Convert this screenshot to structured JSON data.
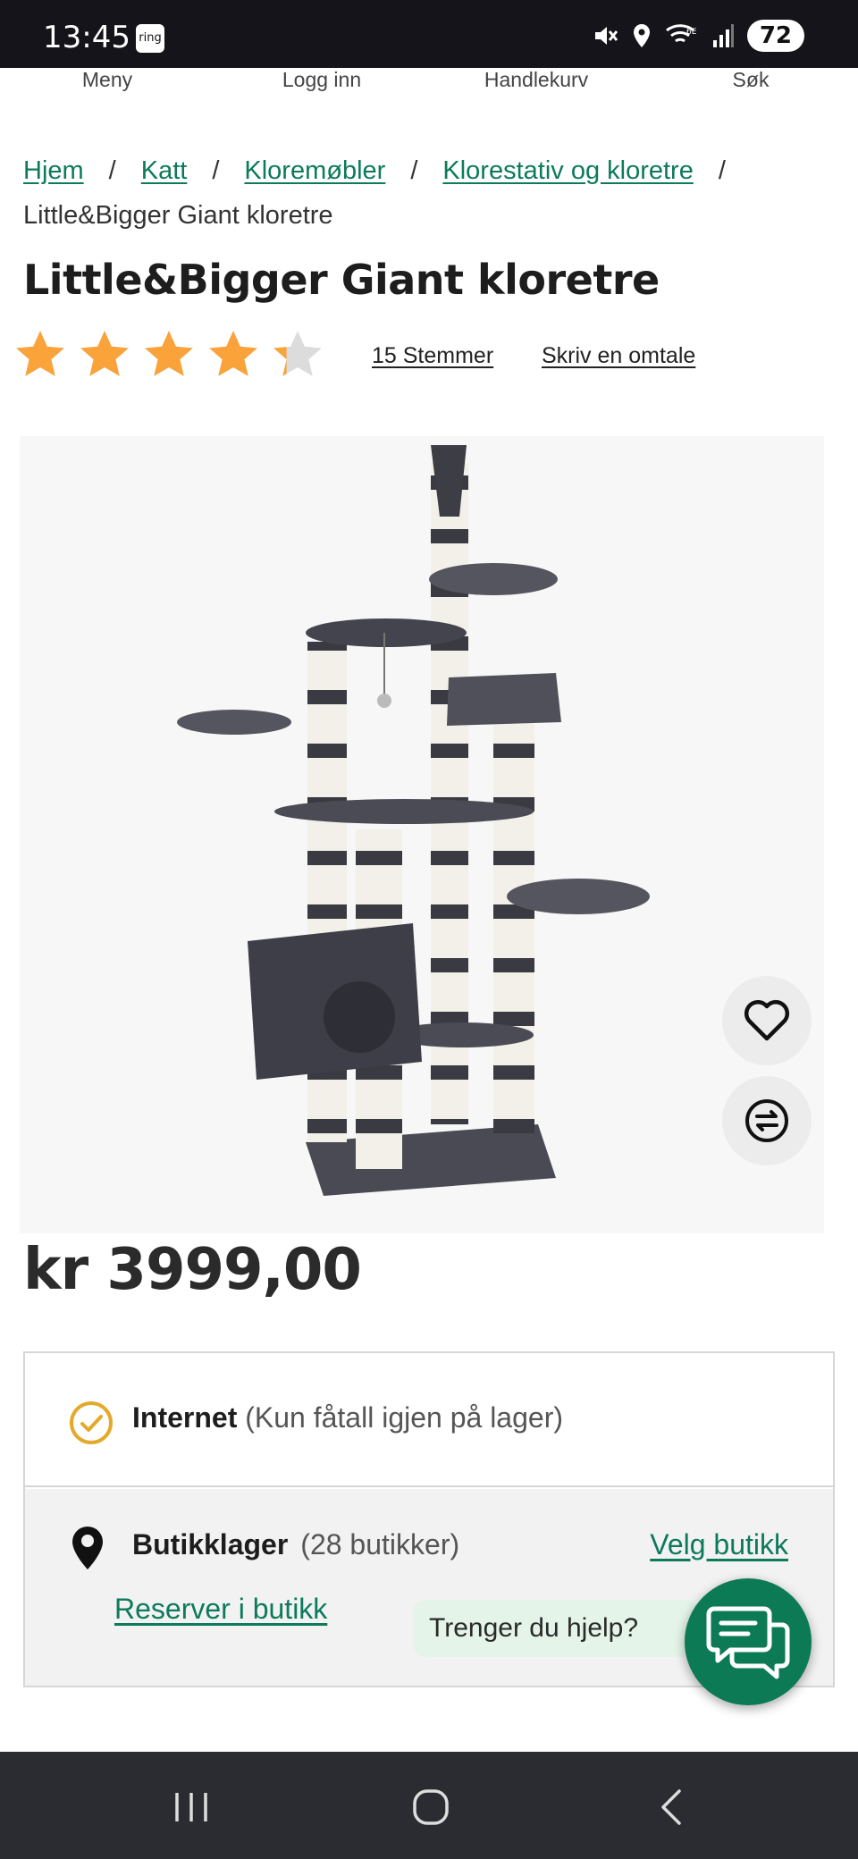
{
  "status_bar": {
    "time": "13:45",
    "ring_label": "ring",
    "battery": "72",
    "icons": [
      "mute-icon",
      "location-icon",
      "wifi-6e-icon",
      "signal-icon"
    ]
  },
  "top_nav": {
    "items": [
      "Meny",
      "Logg inn",
      "Handlekurv",
      "Søk"
    ]
  },
  "breadcrumb": {
    "links": [
      "Hjem",
      "Katt",
      "Kloremøbler",
      "Klorestativ og kloretre"
    ],
    "separator": "/",
    "current": "Little&Bigger Giant kloretre"
  },
  "product": {
    "title": "Little&Bigger Giant kloretre",
    "rating": 4.3,
    "rating_max": 5,
    "votes_label": "15 Stemmer",
    "write_review_label": "Skriv en omtale",
    "price": "kr 3999,00"
  },
  "stock": {
    "internet_label": "Internet",
    "internet_note": "(Kun fåtall igjen på lager)",
    "store_label": "Butikklager",
    "store_count": "(28 butikker)",
    "choose_store_label": "Velg butikk",
    "reserve_label": "Reserver i butikk"
  },
  "help": {
    "bubble_text": "Trenger du hjelp?"
  },
  "colors": {
    "accent_green": "#0d7a5c",
    "star_orange": "#f9a33a",
    "check_yellow": "#e3a92b"
  }
}
